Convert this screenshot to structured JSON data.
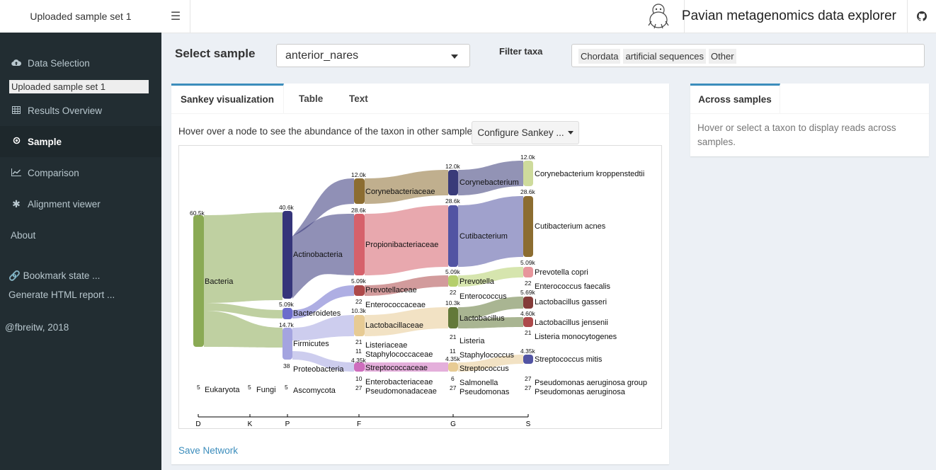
{
  "header": {
    "logo_text": "Uploaded sample set 1",
    "title": "Pavian metagenomics data explorer",
    "toggle_icon": "hamburger-icon",
    "github_icon": "github-icon"
  },
  "sidebar": {
    "items": [
      {
        "label": "Data Selection",
        "icon": "cloud-upload-icon"
      },
      {
        "label": "Results Overview",
        "icon": "table-icon"
      },
      {
        "label": "Sample",
        "icon": "sun-icon"
      },
      {
        "label": "Comparison",
        "icon": "line-chart-icon"
      },
      {
        "label": "Alignment viewer",
        "icon": "asterisk-icon"
      },
      {
        "label": "About",
        "icon": ""
      }
    ],
    "sample_set": "Uploaded sample set 1",
    "bookmark": "Bookmark state ...",
    "report": "Generate HTML report ...",
    "credit": "@fbreitw, 2018"
  },
  "select": {
    "label": "Select sample",
    "value": "anterior_nares",
    "filter_label": "Filter taxa",
    "filters": [
      "Chordata",
      "artificial sequences",
      "Other"
    ]
  },
  "main": {
    "tabs": [
      "Sankey visualization",
      "Table",
      "Text"
    ],
    "hover_text": "Hover over a node to see the abundance of the taxon in other samples.",
    "configure_label": "Configure Sankey ...",
    "save_network": "Save Network"
  },
  "side": {
    "tab": "Across samples",
    "text": "Hover or select a taxon to display reads across samples."
  },
  "sankey": {
    "axis_ticks": [
      "D",
      "K",
      "P",
      "F",
      "G",
      "S"
    ],
    "nodes": [
      {
        "name": "Bacteria",
        "count": "60.5k",
        "color": "#8aaa54"
      },
      {
        "name": "Eukaryota",
        "count": "5",
        "color": "#8aaa54"
      },
      {
        "name": "Fungi",
        "count": "5",
        "color": "#8aaa54"
      },
      {
        "name": "Actinobacteria",
        "count": "40.6k",
        "color": "#35357a"
      },
      {
        "name": "Bacteroidetes",
        "count": "5.09k",
        "color": "#6c6ccc"
      },
      {
        "name": "Firmicutes",
        "count": "14.7k",
        "color": "#a4a4e0"
      },
      {
        "name": "Proteobacteria",
        "count": "38",
        "color": "#a4a4e0"
      },
      {
        "name": "Ascomycota",
        "count": "5",
        "color": "#a4a4e0"
      },
      {
        "name": "Corynebacteriaceae",
        "count": "12.0k",
        "color": "#8c6d31"
      },
      {
        "name": "Propionibacteriaceae",
        "count": "28.6k",
        "color": "#d6616b"
      },
      {
        "name": "Prevotellaceae",
        "count": "5.09k",
        "color": "#ad494a"
      },
      {
        "name": "Enterococcaceae",
        "count": "22",
        "color": "#ad494a"
      },
      {
        "name": "Lactobacillaceae",
        "count": "10.3k",
        "color": "#e7cb94"
      },
      {
        "name": "Listeriaceae",
        "count": "21",
        "color": "#e7cb94"
      },
      {
        "name": "Staphylococcaceae",
        "count": "11",
        "color": "#e7cb94"
      },
      {
        "name": "Streptococcaceae",
        "count": "4.35k",
        "color": "#ce6dbd"
      },
      {
        "name": "Enterobacteriaceae",
        "count": "10",
        "color": "#ce6dbd"
      },
      {
        "name": "Pseudomonadaceae",
        "count": "27",
        "color": "#ce6dbd"
      },
      {
        "name": "Corynebacterium",
        "count": "12.0k",
        "color": "#393b79"
      },
      {
        "name": "Cutibacterium",
        "count": "28.6k",
        "color": "#5254a3"
      },
      {
        "name": "Prevotella",
        "count": "5.09k",
        "color": "#b5cf6b"
      },
      {
        "name": "Enterococcus",
        "count": "22",
        "color": "#b5cf6b"
      },
      {
        "name": "Lactobacillus",
        "count": "10.3k",
        "color": "#637939"
      },
      {
        "name": "Listeria",
        "count": "21",
        "color": "#637939"
      },
      {
        "name": "Staphylococcus",
        "count": "11",
        "color": "#637939"
      },
      {
        "name": "Streptococcus",
        "count": "4.35k",
        "color": "#e7cb94"
      },
      {
        "name": "Salmonella",
        "count": "6",
        "color": "#e7cb94"
      },
      {
        "name": "Pseudomonas",
        "count": "27",
        "color": "#e7cb94"
      },
      {
        "name": "Corynebacterium kroppenstedtii",
        "count": "12.0k",
        "color": "#cedb9c"
      },
      {
        "name": "Cutibacterium acnes",
        "count": "28.6k",
        "color": "#8c6d31"
      },
      {
        "name": "Prevotella copri",
        "count": "5.09k",
        "color": "#e7969c"
      },
      {
        "name": "Enterococcus faecalis",
        "count": "22",
        "color": "#e7969c"
      },
      {
        "name": "Lactobacillus gasseri",
        "count": "5.69k",
        "color": "#843c39"
      },
      {
        "name": "Lactobacillus jensenii",
        "count": "4.60k",
        "color": "#ad494a"
      },
      {
        "name": "Listeria monocytogenes",
        "count": "21",
        "color": "#ad494a"
      },
      {
        "name": "Streptococcus mitis",
        "count": "4.35k",
        "color": "#5254a3"
      },
      {
        "name": "Pseudomonas aeruginosa group",
        "count": "27",
        "color": "#5254a3"
      },
      {
        "name": "Pseudomonas aeruginosa",
        "count": "27",
        "color": "#5254a3"
      }
    ]
  }
}
